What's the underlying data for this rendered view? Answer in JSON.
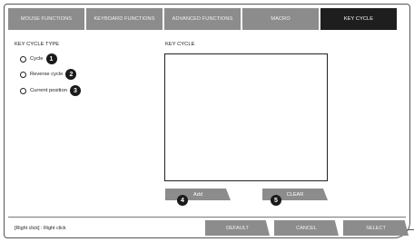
{
  "tabs": [
    {
      "label": "MOUSE FUNCTIONS",
      "active": false
    },
    {
      "label": "KEYBOARD FUNCTIONS",
      "active": false
    },
    {
      "label": "ADVANCED FUNCTIONS",
      "active": false
    },
    {
      "label": "MACRO",
      "active": false
    },
    {
      "label": "KEY CYCLE",
      "active": true
    }
  ],
  "key_cycle_type": {
    "title": "KEY CYCLE TYPE",
    "options": [
      {
        "label": "Cycle",
        "badge": "1"
      },
      {
        "label": "Reverse cycle",
        "badge": "2"
      },
      {
        "label": "Current position",
        "badge": "3"
      }
    ]
  },
  "key_cycle": {
    "title": "KEY CYCLE",
    "add_label": "Add",
    "add_badge": "4",
    "clear_label": "CLEAR",
    "clear_badge": "5"
  },
  "footer": {
    "status": "[Right click] : Right click",
    "default_label": "DEFAULT",
    "cancel_label": "CANCEL",
    "select_label": "SELECT"
  }
}
